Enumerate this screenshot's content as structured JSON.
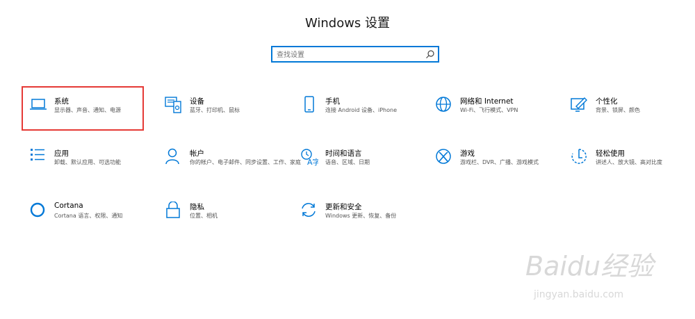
{
  "window": {
    "title": "Windows 设置"
  },
  "search": {
    "placeholder": "查找设置"
  },
  "tiles": [
    {
      "title": "系统",
      "subtitle": "显示器、声音、通知、电源",
      "icon": "laptop-icon"
    },
    {
      "title": "设备",
      "subtitle": "蓝牙、打印机、鼠标",
      "icon": "devices-icon"
    },
    {
      "title": "手机",
      "subtitle": "连接 Android 设备、iPhone",
      "icon": "phone-icon"
    },
    {
      "title": "网络和 Internet",
      "subtitle": "Wi-Fi、飞行模式、VPN",
      "icon": "globe-icon"
    },
    {
      "title": "个性化",
      "subtitle": "背景、锁屏、颜色",
      "icon": "personalization-icon"
    },
    {
      "title": "应用",
      "subtitle": "卸载、默认应用、可选功能",
      "icon": "apps-list-icon"
    },
    {
      "title": "帐户",
      "subtitle": "你的帐户、电子邮件、同步设置、工作、家庭",
      "icon": "person-icon"
    },
    {
      "title": "时间和语言",
      "subtitle": "语音、区域、日期",
      "icon": "time-language-icon"
    },
    {
      "title": "游戏",
      "subtitle": "游戏栏、DVR、广播、游戏模式",
      "icon": "xbox-icon"
    },
    {
      "title": "轻松使用",
      "subtitle": "讲述人、放大镜、高对比度",
      "icon": "ease-of-access-icon"
    },
    {
      "title": "Cortana",
      "subtitle": "Cortana 语言、权限、通知",
      "icon": "cortana-icon"
    },
    {
      "title": "隐私",
      "subtitle": "位置、相机",
      "icon": "lock-icon"
    },
    {
      "title": "更新和安全",
      "subtitle": "Windows 更新、恢复、备份",
      "icon": "sync-icon"
    }
  ],
  "watermark": {
    "logo": "Baidu经验",
    "url": "jingyan.baidu.com"
  },
  "colors": {
    "accent": "#0078d7",
    "highlight": "#e53935"
  }
}
